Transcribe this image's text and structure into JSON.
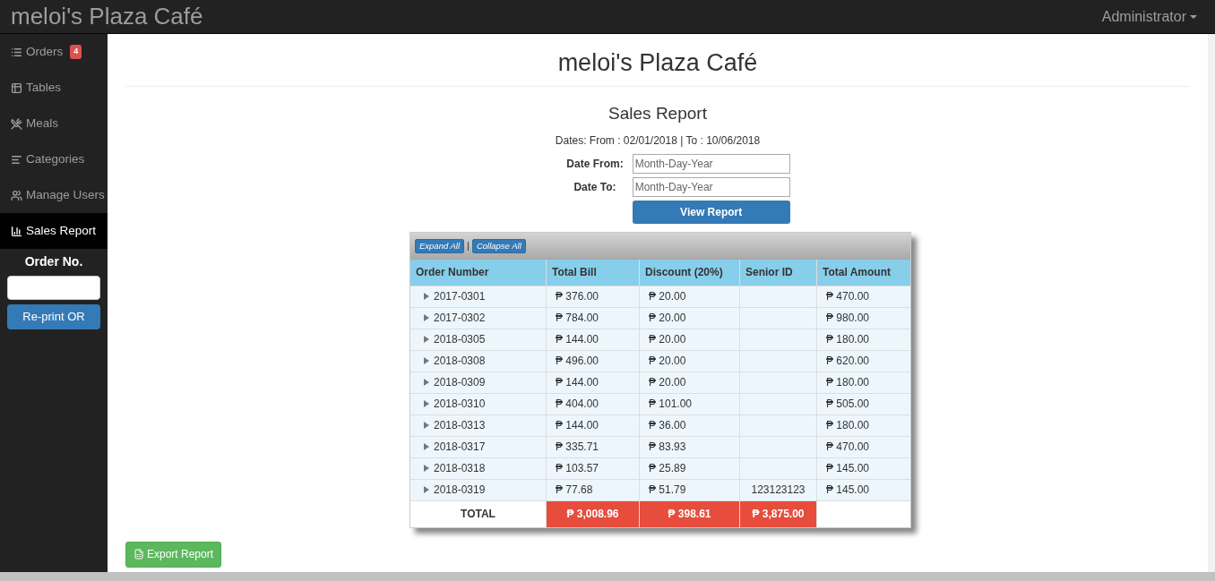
{
  "navbar": {
    "brand": "meloi's Plaza Café",
    "user": "Administrator"
  },
  "sidebar": {
    "items": [
      {
        "label": "Orders",
        "badge": "4",
        "selected": false
      },
      {
        "label": "Tables",
        "selected": false
      },
      {
        "label": "Meals",
        "selected": false
      },
      {
        "label": "Categories",
        "selected": false
      },
      {
        "label": "Manage Users",
        "selected": false
      },
      {
        "label": "Sales Report",
        "selected": true
      }
    ],
    "order_no": {
      "label": "Order No.",
      "button": "Re-print OR"
    }
  },
  "page": {
    "title": "meloi's Plaza Café",
    "report_title": "Sales Report",
    "dates": "Dates: From : 02/01/2018 | To : 10/06/2018",
    "date_from": {
      "label": "Date From:",
      "placeholder": "Month-Day-Year"
    },
    "date_to": {
      "label": "Date To:",
      "placeholder": "Month-Day-Year"
    },
    "view_button": "View Report",
    "toolbar": {
      "expand": "Expand All",
      "separator": "|",
      "collapse": "Collapse All"
    },
    "table": {
      "columns": [
        "Order Number",
        "Total Bill",
        "Discount (20%)",
        "Senior ID",
        "Total Amount"
      ],
      "rows": [
        {
          "expanded": false,
          "cells": [
            "2017-0301",
            "₱ 376.00",
            "₱ 20.00",
            "",
            "₱ 470.00"
          ]
        },
        {
          "expanded": false,
          "cells": [
            "2017-0302",
            "₱ 784.00",
            "₱ 20.00",
            "",
            "₱ 980.00"
          ]
        },
        {
          "expanded": false,
          "cells": [
            "2018-0305",
            "₱ 144.00",
            "₱ 20.00",
            "",
            "₱ 180.00"
          ]
        },
        {
          "expanded": false,
          "cells": [
            "2018-0308",
            "₱ 496.00",
            "₱ 20.00",
            "",
            "₱ 620.00"
          ]
        },
        {
          "expanded": false,
          "cells": [
            "2018-0309",
            "₱ 144.00",
            "₱ 20.00",
            "",
            "₱ 180.00"
          ]
        },
        {
          "expanded": false,
          "cells": [
            "2018-0310",
            "₱ 404.00",
            "₱ 101.00",
            "",
            "₱ 505.00"
          ]
        },
        {
          "expanded": false,
          "cells": [
            "2018-0313",
            "₱ 144.00",
            "₱ 36.00",
            "",
            "₱ 180.00"
          ]
        },
        {
          "expanded": false,
          "cells": [
            "2018-0317",
            "₱ 335.71",
            "₱ 83.93",
            "",
            "₱ 470.00"
          ]
        },
        {
          "expanded": false,
          "cells": [
            "2018-0318",
            "₱ 103.57",
            "₱ 25.89",
            "",
            "₱ 145.00"
          ]
        },
        {
          "expanded": false,
          "cells": [
            "2018-0319",
            "₱ 77.68",
            "₱ 51.79",
            "123123123",
            "₱ 145.00"
          ]
        }
      ],
      "total": {
        "label": "TOTAL",
        "values": [
          "₱ 3,008.96",
          "₱ 398.61",
          "₱ 3,875.00"
        ]
      }
    },
    "export_button": "Export Report"
  }
}
